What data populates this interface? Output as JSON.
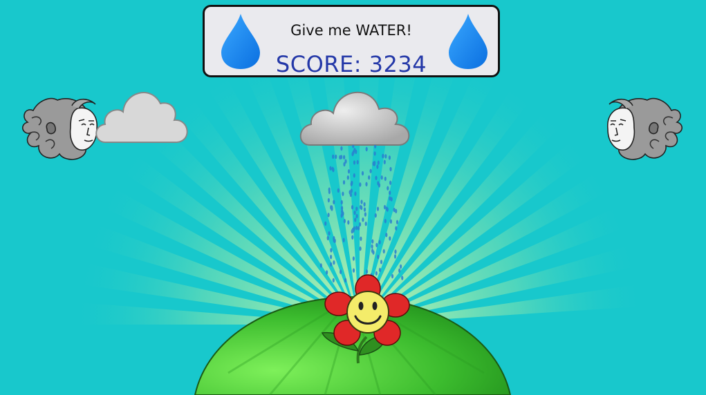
{
  "hud": {
    "message": "Give me WATER!",
    "score_label": "SCORE:",
    "score_value": "3234",
    "score_text": "SCORE: 3234"
  },
  "colors": {
    "sky": "#18c8cc",
    "score_text": "#2438a8",
    "panel_bg": "#eaeaee",
    "drop": "#1e88f0",
    "hill": "#3fc23a",
    "petal": "#e02828",
    "face": "#f4ec6a"
  },
  "icons": {
    "left_drop": "water-drop-icon",
    "right_drop": "water-drop-icon",
    "wind_left": "wind-god-face-icon",
    "wind_right": "wind-god-face-icon",
    "cloud_left": "cloud-icon",
    "rain_cloud": "rain-cloud-icon",
    "flower": "smiley-flower-icon"
  }
}
